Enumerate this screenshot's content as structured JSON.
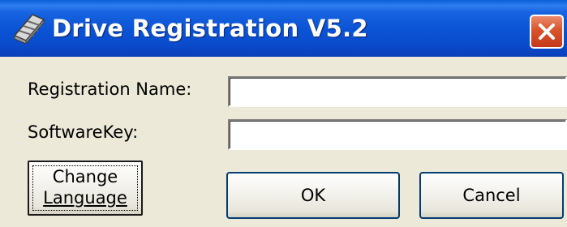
{
  "window": {
    "title": "Drive Registration V5.2",
    "icon": "drive-app-icon",
    "close_icon": "close-icon",
    "accent_color": "#0a54d6",
    "close_color": "#d9542b"
  },
  "form": {
    "registration_name_label": "Registration Name:",
    "registration_name_value": "",
    "software_key_label": "SoftwareKey:",
    "software_key_value": ""
  },
  "buttons": {
    "change_language_line1": "Change",
    "change_language_line2": "Language",
    "ok_label": "OK",
    "cancel_label": "Cancel"
  }
}
